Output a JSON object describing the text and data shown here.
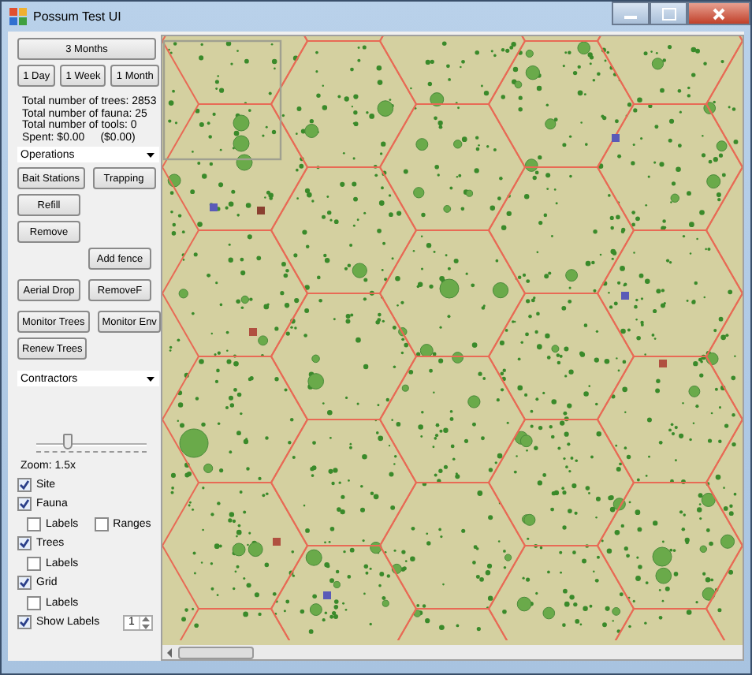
{
  "window": {
    "title": "Possum Test UI"
  },
  "period_button": "3 Months",
  "range_buttons": [
    "1 Day",
    "1 Week",
    "1 Month"
  ],
  "stats": [
    "Total number of trees: 2853",
    "Total number of fauna: 25",
    "Total number of tools: 0"
  ],
  "spent": {
    "label": "Spent: $0.00",
    "value": "($0.00)"
  },
  "operations_dropdown": {
    "value": "Operations"
  },
  "operation_rows": [
    {
      "left": "Bait Stations",
      "right": "Trapping"
    },
    {
      "left": "Refill"
    },
    {
      "left": "Remove"
    },
    {
      "right": "Add fence"
    },
    {
      "left": "Aerial Drop",
      "right": "RemoveF"
    },
    {
      "left": "Monitor Trees",
      "right": "Monitor Env"
    },
    {
      "left": "Renew Trees"
    }
  ],
  "contractors_dropdown": {
    "value": "Contractors"
  },
  "zoom": {
    "level": 0.28,
    "label": "Zoom: 1.5x"
  },
  "layers": [
    {
      "label": "Site",
      "checked": true
    },
    {
      "label": "Fauna",
      "checked": true,
      "children": [
        {
          "label": "Labels",
          "checked": false
        },
        {
          "label": "Ranges",
          "checked": false
        }
      ]
    },
    {
      "label": "Trees",
      "checked": true,
      "children": [
        {
          "label": "Labels",
          "checked": false
        }
      ]
    },
    {
      "label": "Grid",
      "checked": true,
      "children": [
        {
          "label": "Labels",
          "checked": false
        }
      ]
    },
    {
      "label": "Show Labels",
      "checked": true,
      "spinner": "1"
    }
  ]
}
